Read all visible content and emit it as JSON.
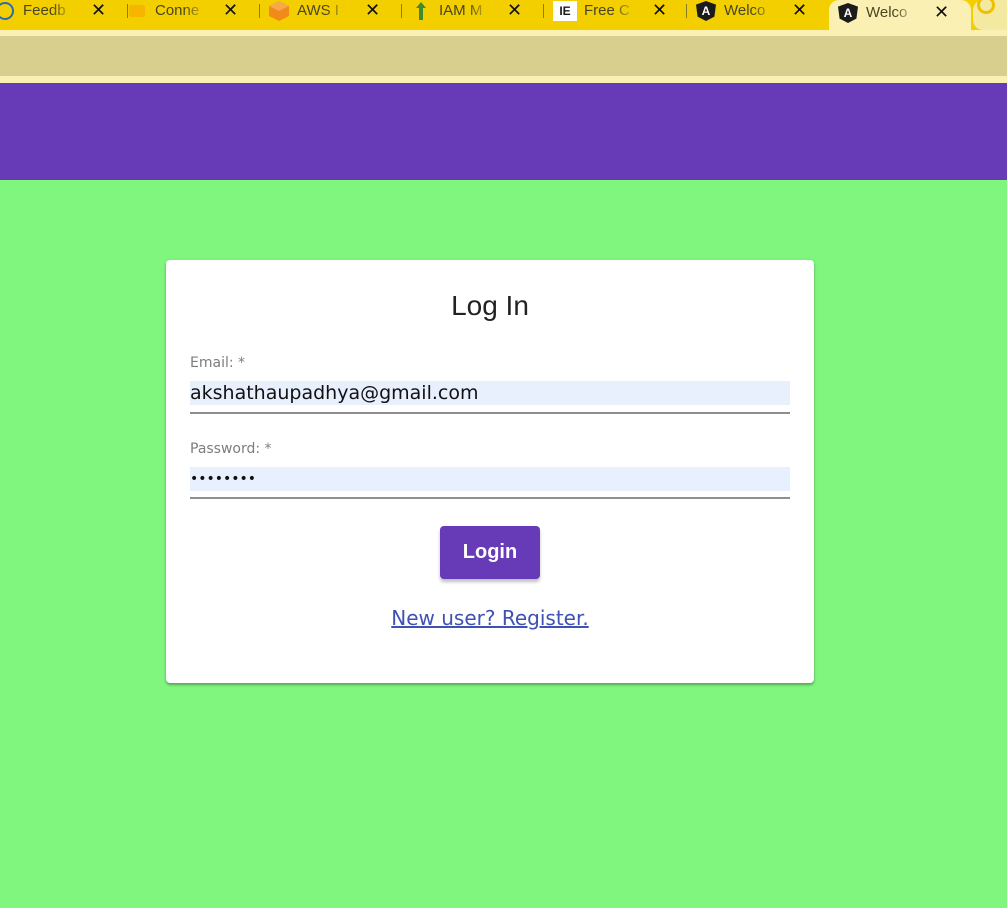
{
  "browser": {
    "tabs": [
      {
        "title": "Feedb",
        "icon": "feedback-icon"
      },
      {
        "title": "Conne",
        "icon": "folder-icon"
      },
      {
        "title": "AWS I",
        "icon": "aws-cube-icon"
      },
      {
        "title": "IAM M",
        "icon": "iam-icon"
      },
      {
        "title": "Free C",
        "icon": "ie-icon",
        "icon_text": "IE"
      },
      {
        "title": "Welco",
        "icon": "angular-icon",
        "icon_text": "A"
      },
      {
        "title": "Welco",
        "icon": "angular-icon",
        "icon_text": "A",
        "active": true
      }
    ],
    "close_glyph": "✕"
  },
  "colors": {
    "page_background": "#80f67e",
    "header": "#673ab7",
    "tab_strip": "#f3cf00",
    "active_tab": "#fbf0b3",
    "address_bar": "#d8cf8e",
    "autofill": "#e8f0fe",
    "link": "#3f51b5"
  },
  "login": {
    "title": "Log In",
    "email_label": "Email: *",
    "email_value": "akshathaupadhya@gmail.com",
    "password_label": "Password: *",
    "password_value": "password",
    "submit_label": "Login",
    "register_link": "New user? Register."
  }
}
